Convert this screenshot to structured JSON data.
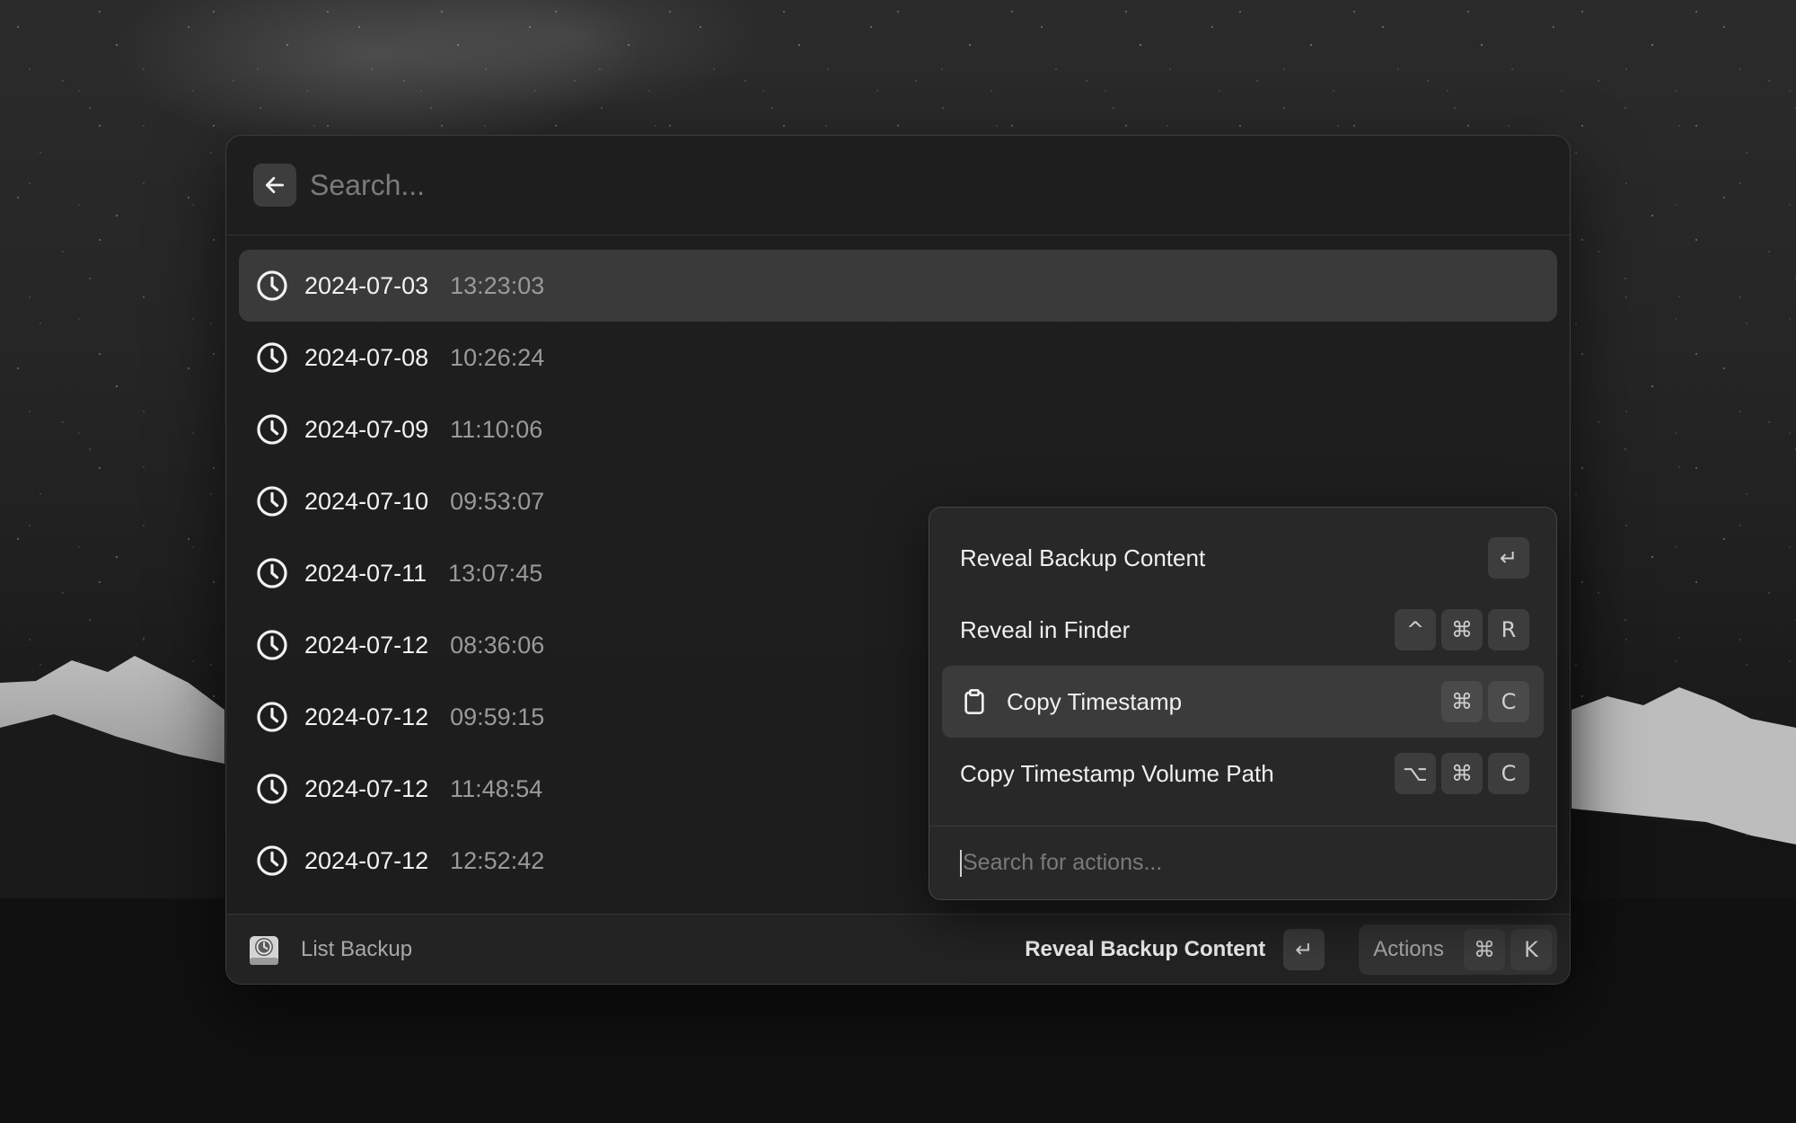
{
  "search": {
    "placeholder": "Search..."
  },
  "backups": [
    {
      "date": "2024-07-03",
      "time": "13:23:03"
    },
    {
      "date": "2024-07-08",
      "time": "10:26:24"
    },
    {
      "date": "2024-07-09",
      "time": "11:10:06"
    },
    {
      "date": "2024-07-10",
      "time": "09:53:07"
    },
    {
      "date": "2024-07-11",
      "time": "13:07:45"
    },
    {
      "date": "2024-07-12",
      "time": "08:36:06"
    },
    {
      "date": "2024-07-12",
      "time": "09:59:15"
    },
    {
      "date": "2024-07-12",
      "time": "11:48:54"
    },
    {
      "date": "2024-07-12",
      "time": "12:52:42"
    }
  ],
  "footer": {
    "command_name": "List Backup",
    "primary_action": "Reveal Backup Content",
    "primary_key": "↵",
    "actions_label": "Actions",
    "actions_keys": [
      "⌘",
      "K"
    ]
  },
  "action_panel": {
    "items": [
      {
        "label": "Reveal Backup Content",
        "keys": [
          "↵"
        ],
        "icon": ""
      },
      {
        "label": "Reveal in Finder",
        "keys": [
          "^",
          "⌘",
          "R"
        ],
        "icon": ""
      },
      {
        "label": "Copy Timestamp",
        "keys": [
          "⌘",
          "C"
        ],
        "icon": "clipboard-icon"
      },
      {
        "label": "Copy Timestamp Volume Path",
        "keys": [
          "⌥",
          "⌘",
          "C"
        ],
        "icon": ""
      }
    ],
    "search_placeholder": "Search for actions..."
  },
  "icons": {
    "back": "arrow-left-icon",
    "row": "clock-icon",
    "app": "time-machine-icon"
  }
}
